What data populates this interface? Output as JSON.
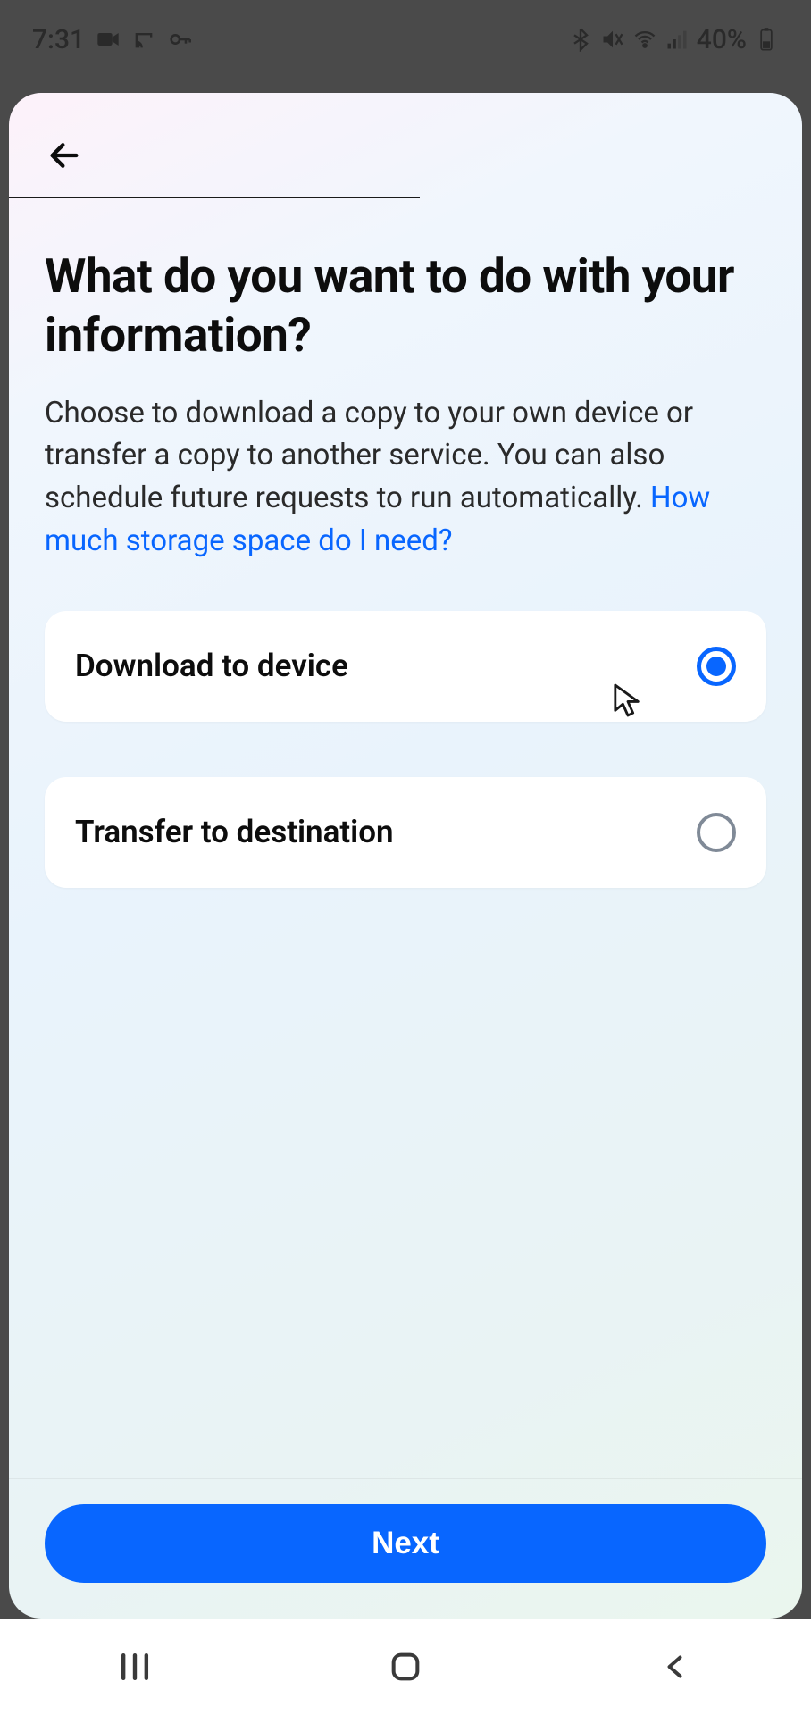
{
  "status": {
    "time": "7:31",
    "battery_text": "40%"
  },
  "page": {
    "heading": "What do you want to do with your information?",
    "description_pre": "Choose to download a copy to your own device or transfer a copy to another service. You can also schedule future requests to run automatically. ",
    "storage_link": "How much storage space do I need?"
  },
  "options": [
    {
      "label": "Download to device",
      "selected": true
    },
    {
      "label": "Transfer to destination",
      "selected": false
    }
  ],
  "footer": {
    "next_label": "Next"
  }
}
